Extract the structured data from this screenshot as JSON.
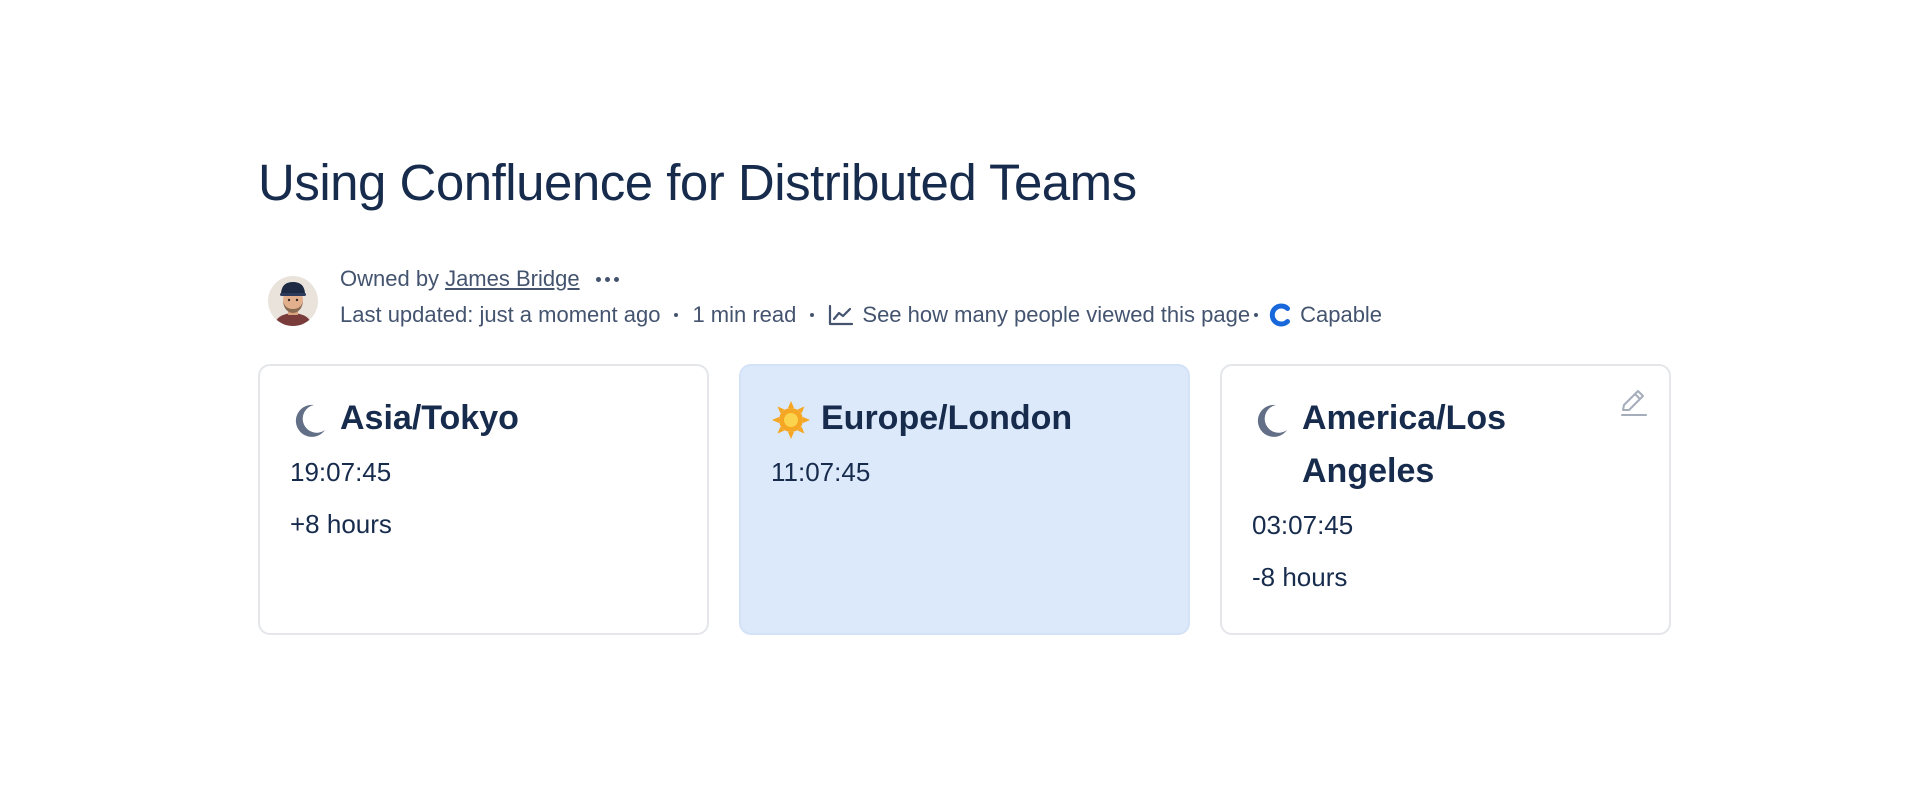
{
  "page": {
    "title": "Using Confluence for Distributed Teams"
  },
  "byline": {
    "owned_by_label": "Owned by",
    "owner_name": "James Bridge",
    "last_updated": "Last updated: just a moment ago",
    "read_time": "1 min read",
    "views_link": "See how many people viewed this page",
    "app_name": "Capable"
  },
  "icons": {
    "more": "more-actions-icon",
    "analytics": "analytics-chart-icon",
    "capable": "capable-logo-icon",
    "moon": "moon-icon",
    "sun": "sun-icon",
    "edit": "pencil-edit-icon"
  },
  "colors": {
    "title": "#172b4d",
    "meta_text": "#44546f",
    "highlight_card_bg": "#dce9fb",
    "sun": "#f5a623",
    "moon": "#626f86",
    "capable_brand": "#1868db"
  },
  "clocks": [
    {
      "zone": "Asia/Tokyo",
      "time": "19:07:45",
      "offset": "+8 hours",
      "icon": "moon-icon",
      "highlighted": false
    },
    {
      "zone": "Europe/London",
      "time": "11:07:45",
      "offset": "",
      "icon": "sun-icon",
      "highlighted": true
    },
    {
      "zone": "America/Los Angeles",
      "time": "03:07:45",
      "offset": "-8 hours",
      "icon": "moon-icon",
      "highlighted": false
    }
  ]
}
